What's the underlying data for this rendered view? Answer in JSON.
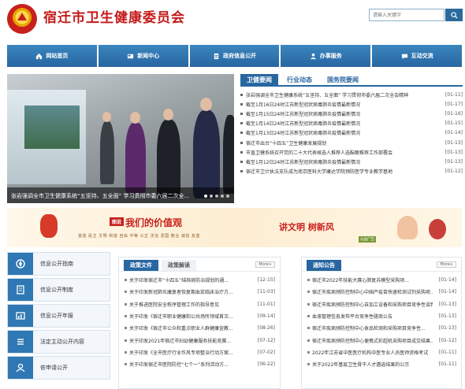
{
  "site": {
    "title": "宿迁市卫生健康委员会"
  },
  "search": {
    "placeholder": "请输入关键字"
  },
  "nav": [
    {
      "label": "网站首页",
      "icon": "home-icon"
    },
    {
      "label": "新闻中心",
      "icon": "news-icon"
    },
    {
      "label": "政府信息公开",
      "icon": "document-icon"
    },
    {
      "label": "办事服务",
      "icon": "service-icon"
    },
    {
      "label": "互动交流",
      "icon": "chat-icon"
    }
  ],
  "slide": {
    "caption": "张岩强调全市卫生健康系统“五坚持、五全面” 学习贯彻市委六届二次全...",
    "dot_count": 5,
    "active_dot": 0
  },
  "news_tabs": [
    "卫健要闻",
    "行业动态",
    "国务院要闻"
  ],
  "news": [
    {
      "title": "张岩强调全市卫生健康系统“五坚持、五全面” 学习贯彻市委六届二次全会精神",
      "date": "[01-11]"
    },
    {
      "title": "截至1月16日24时江苏新型冠状病毒肺炎疫情最新情况",
      "date": "[01-17]"
    },
    {
      "title": "截至1月15日24时江苏新型冠状病毒肺炎疫情最新情况",
      "date": "[01-16]"
    },
    {
      "title": "截至1月14日24时江苏新型冠状病毒肺炎疫情最新情况",
      "date": "[01-15]"
    },
    {
      "title": "截至1月13日24时江苏新型冠状病毒肺炎疫情最新情况",
      "date": "[01-14]"
    },
    {
      "title": "宿迁市出台“十四五”卫生健康发展规划",
      "date": "[01-13]"
    },
    {
      "title": "市直卫健系统召开党的二十大代表候选人推荐人选酝酿推荐工作部署会",
      "date": "[01-13]"
    },
    {
      "title": "截至1月12日24时江苏新型冠状病毒肺炎疫情最新情况",
      "date": "[01-13]"
    },
    {
      "title": "宿迁市卫计执法支队成为南京医科大学康达学院预防医学专业教学基地",
      "date": "[01-12]"
    }
  ],
  "banner": {
    "badge": "图说",
    "value_title": "我们的价值观",
    "values_line": "富强 民主 文明 和谐 自由 平等 公正 法治 爱国 敬业 诚信 友善",
    "slogan": "讲文明 树新风",
    "ad_label": "公益广告"
  },
  "side_links": [
    {
      "label": "信息公开指南",
      "icon": "compass-icon"
    },
    {
      "label": "信息公开制度",
      "icon": "rules-icon"
    },
    {
      "label": "信息公开年报",
      "icon": "report-icon"
    },
    {
      "label": "法定主动公开内容",
      "icon": "list-icon"
    },
    {
      "label": "依申请公开",
      "icon": "apply-icon"
    }
  ],
  "policy": {
    "tabs": [
      "政策文件",
      "政策解读"
    ],
    "more": "More+",
    "items": [
      {
        "title": "关于印发宿迁市“十四五”结核病防治规划的通...",
        "date": "[12-15]"
      },
      {
        "title": "关于印发新冠肺炎康复者恢复期血浆临床治疗方...",
        "date": "[11-03]"
      },
      {
        "title": "关于推进医院安全秩序管理工作的指导意见",
        "date": "[11-01]"
      },
      {
        "title": "关于印发《宿迁市职业健康和公共场所领域首次...",
        "date": "[09-14]"
      },
      {
        "title": "关于印发《宿迁市公众和重点职业人群健康宣教...",
        "date": "[08-26]"
      },
      {
        "title": "关于印发2021年宿迁市妇幼健康服务技能竞赛...",
        "date": "[07-12]"
      },
      {
        "title": "关于印发《全市医疗行业作风专项整治行动方案...",
        "date": "[07-02]"
      },
      {
        "title": "关于印发宿迁市医院防控“七个一”系列活动方...",
        "date": "[06-22]"
      }
    ]
  },
  "notice": {
    "tabs": [
      "通知公告"
    ],
    "more": "More+",
    "items": [
      {
        "title": "宿迁市2022年技能大赛心肺复苏模型采购项...",
        "date": "[01-14]"
      },
      {
        "title": "宿迁市疾病预防控制中心中国产疫苗快速检测试剂采购项...",
        "date": "[01-14]"
      },
      {
        "title": "宿迁市疾病预防控制中心自加工设备和采购项目竞争性谈判公...",
        "date": "[01-13]"
      },
      {
        "title": "血液管理信息发布平台竞争性磋商公告",
        "date": "[01-13]"
      },
      {
        "title": "宿迁市疾病预防控制中心食品检测和采购项目竞争性...",
        "date": "[01-13]"
      },
      {
        "title": "宿迁市疾病预防控制中心便携式彩超机采购项目成交结果...",
        "date": "[01-12]"
      },
      {
        "title": "2022年江苏省中医医疗机构中医专业人员医师资格考试",
        "date": "[01-11]"
      },
      {
        "title": "关于2022年基层卫生骨干人才遴选结果的公示",
        "date": "[01-11]"
      }
    ]
  },
  "colors": {
    "brand_red": "#c41a1a",
    "nav_blue": "#2766a1"
  }
}
